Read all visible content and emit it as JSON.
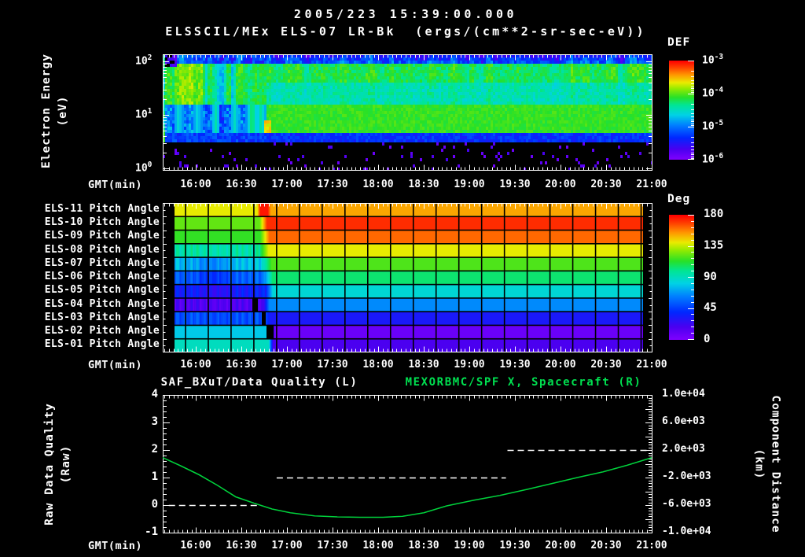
{
  "header": {
    "date_line": "2005/223 15:39:00.000",
    "instrument_line": "ELSSCIL/MEx ELS-07 LR-Bk  (ergs/(cm**2-sr-sec-eV))"
  },
  "axis": {
    "x_label": "GMT(min)",
    "x_tick_labels": [
      "16:00",
      "16:30",
      "17:00",
      "17:30",
      "18:00",
      "18:30",
      "19:00",
      "19:30",
      "20:00",
      "20:30",
      "21:00"
    ],
    "start_time": "15:38",
    "end_time": "21:01",
    "minutes_span": 322.5
  },
  "colors": {
    "background": "#000000",
    "axis": "#ffffff",
    "right_series_green": "#00d23c",
    "quality_dash_white": "#ffffff"
  },
  "colormap_stops": [
    [
      0.0,
      127,
      0,
      255
    ],
    [
      0.1,
      75,
      0,
      240
    ],
    [
      0.22,
      0,
      40,
      255
    ],
    [
      0.35,
      0,
      130,
      255
    ],
    [
      0.45,
      0,
      210,
      230
    ],
    [
      0.55,
      0,
      230,
      150
    ],
    [
      0.63,
      40,
      225,
      40
    ],
    [
      0.72,
      150,
      235,
      0
    ],
    [
      0.78,
      235,
      235,
      0
    ],
    [
      0.86,
      255,
      150,
      0
    ],
    [
      0.93,
      255,
      70,
      0
    ],
    [
      1.0,
      255,
      0,
      0
    ]
  ],
  "chart_data": [
    {
      "id": "electron-energy-spectrogram",
      "type": "heatmap",
      "title": "ELSSCIL/MEx ELS-07 LR-Bk",
      "units": "(ergs/(cm**2-sr-sec-eV))",
      "xlabel": "GMT(min)",
      "ylabel_line1": "Electron Energy",
      "ylabel_line2": "(eV)",
      "y_scale": "log",
      "y_range_ev": [
        1,
        135
      ],
      "y_tick_labels": [
        {
          "base": "10",
          "exp": "2"
        },
        {
          "base": "10",
          "exp": "1"
        },
        {
          "base": "10",
          "exp": "0"
        }
      ],
      "colorbar": {
        "label": "DEF",
        "tick_labels": [
          {
            "base": "10",
            "exp": "-3"
          },
          {
            "base": "10",
            "exp": "-4"
          },
          {
            "base": "10",
            "exp": "-5"
          },
          {
            "base": "10",
            "exp": "-6"
          }
        ],
        "min_flux": "1e-6",
        "max_flux": "1e-3"
      },
      "transition_minute": 69,
      "bands_pre": [
        {
          "e": [
            1,
            3.2
          ],
          "u": -1,
          "speckle_p": 0.05,
          "speckle_u": 0.08
        },
        {
          "e": [
            3.2,
            4.6
          ],
          "u": 0.25,
          "noise": 0.06
        },
        {
          "e": [
            4.6,
            15
          ],
          "u": 0.33,
          "noise": 0.1,
          "streak": 0.1,
          "id": "pre-low"
        },
        {
          "e": [
            15,
            90
          ],
          "u": 0.62,
          "noise": 0.05,
          "streak": 0.08,
          "boost_t": [
            8,
            26
          ],
          "boost": 0.07,
          "dip_t": [
            28,
            50
          ],
          "dip": 0.1
        },
        {
          "e": [
            90,
            135
          ],
          "u": 0.28,
          "noise": 0.09,
          "streak": 0.12
        }
      ],
      "bands_post": [
        {
          "e": [
            1,
            3.2
          ],
          "u": -1,
          "speckle_p": 0.05,
          "speckle_u": 0.08
        },
        {
          "e": [
            3.2,
            4.6
          ],
          "u": 0.23,
          "noise": 0.05
        },
        {
          "e": [
            4.6,
            15
          ],
          "u": 0.64,
          "noise": 0.03
        },
        {
          "e": [
            15,
            38
          ],
          "u": 0.52,
          "noise": 0.05,
          "streak": 0.04
        },
        {
          "e": [
            38,
            95
          ],
          "u": 0.6,
          "noise": 0.05,
          "streak": 0.08
        },
        {
          "e": [
            95,
            135
          ],
          "u": 0.28,
          "noise": 0.08,
          "streak": 0.14,
          "fade_top": 0.12
        }
      ],
      "features": [
        {
          "type": "dark_blocks",
          "t": [
            0,
            9
          ],
          "e": [
            80,
            135
          ]
        },
        {
          "type": "bright_left_edge",
          "t": [
            0,
            2
          ]
        },
        {
          "type": "bright_spot",
          "t": [
            67.5,
            71.5
          ],
          "e": [
            4.6,
            7.5
          ],
          "u": 0.8
        }
      ]
    },
    {
      "id": "pitch-angle-panel",
      "type": "heatmap",
      "xlabel": "GMT(min)",
      "colorbar": {
        "label": "Deg",
        "ticks": [
          180,
          135,
          90,
          45,
          0
        ],
        "min": 0,
        "max": 180
      },
      "cell_minutes": 15,
      "no_data_minutes": [
        [
          0,
          7.5
        ],
        [
          316,
          322.5
        ]
      ],
      "rows": [
        {
          "label": "ELS-11 Pitch Angle",
          "left_deg": 140,
          "right_deg": 152,
          "switch_min": 69,
          "blend_min": 3,
          "patch": {
            "t": [
              62,
              71
            ],
            "deg": 176
          },
          "gaps": [],
          "striation": false
        },
        {
          "label": "ELS-10 Pitch Angle",
          "left_deg": 122,
          "right_deg": 172,
          "switch_min": 66,
          "blend_min": 5,
          "patch": null,
          "gaps": [],
          "striation": false
        },
        {
          "label": "ELS-09 Pitch Angle",
          "left_deg": 115,
          "right_deg": 162,
          "switch_min": 67,
          "blend_min": 6,
          "patch": null,
          "gaps": [],
          "striation": false
        },
        {
          "label": "ELS-08 Pitch Angle",
          "left_deg": 95,
          "right_deg": 140,
          "switch_min": 66,
          "blend_min": 7,
          "patch": null,
          "gaps": [],
          "striation": true
        },
        {
          "label": "ELS-07 Pitch Angle",
          "left_deg": 78,
          "right_deg": 119,
          "switch_min": 68,
          "blend_min": 7,
          "patch": null,
          "gaps": [],
          "blob": {
            "c": 30,
            "s": 14,
            "d": -14
          },
          "striation": true
        },
        {
          "label": "ELS-06 Pitch Angle",
          "left_deg": 55,
          "right_deg": 104,
          "switch_min": 69,
          "blend_min": 6,
          "patch": null,
          "gaps": [],
          "blob": {
            "c": 32,
            "s": 13,
            "d": -12
          },
          "striation": true
        },
        {
          "label": "ELS-05 Pitch Angle",
          "left_deg": 36,
          "right_deg": 85,
          "switch_min": 70,
          "blend_min": 5,
          "patch": null,
          "gaps": [],
          "blob": {
            "c": 34,
            "s": 12,
            "d": -8
          },
          "striation": true
        },
        {
          "label": "ELS-04 Pitch Angle",
          "left_deg": 16,
          "right_deg": 65,
          "switch_min": 68,
          "blend_min": 4,
          "patch": null,
          "gaps": [
            [
              59,
              62.5
            ]
          ],
          "striation": true
        },
        {
          "label": "ELS-03 Pitch Angle",
          "left_deg": 50,
          "right_deg": 32,
          "switch_min": 69,
          "blend_min": 4,
          "patch": null,
          "gaps": [
            [
              65,
              67.5
            ]
          ],
          "striation": true
        },
        {
          "label": "ELS-02 Pitch Angle",
          "left_deg": 79,
          "right_deg": 7,
          "switch_min": 72,
          "blend_min": 3,
          "patch": null,
          "gaps": [
            [
              68,
              72.5
            ]
          ],
          "striation": false
        },
        {
          "label": "ELS-01 Pitch Angle",
          "left_deg": 90,
          "right_deg": 18,
          "switch_min": 71,
          "blend_min": 3,
          "patch": null,
          "gaps": [],
          "striation": false
        }
      ]
    },
    {
      "id": "quality-and-distance",
      "type": "line",
      "title_left": "SAF_BXuT/Data Quality (L)",
      "title_right": "MEXORBMC/SPF X, Spacecraft (R)",
      "xlabel": "GMT(min)",
      "y_left": {
        "label_line1": "Raw Data Quality",
        "label_line2": "(Raw)",
        "ticks": [
          4,
          3,
          2,
          1,
          0,
          -1
        ],
        "range": [
          -1,
          4
        ]
      },
      "y_right": {
        "label_line1": "Component Distance",
        "label_line2": "(km)",
        "tick_labels": [
          "1.0e+04",
          "6.0e+03",
          "2.0e+03",
          "-2.0e+03",
          "-6.0e+03",
          "-1.0e+04"
        ],
        "range": [
          -10000,
          10000
        ]
      },
      "series": [
        {
          "name": "SAF_BXuT/Data Quality",
          "axis": "left",
          "style": "dashed",
          "color": "#ffffff",
          "segments": [
            {
              "t": [
                4,
                63
              ],
              "value": 0
            },
            {
              "t": [
                75,
                226
              ],
              "value": 1
            },
            {
              "t": [
                227,
                320.5
              ],
              "value": 2
            }
          ]
        },
        {
          "name": "MEXORBMC/SPF X, Spacecraft",
          "axis": "right",
          "style": "solid",
          "color": "#00d23c",
          "points_min_km": [
            [
              0,
              880
            ],
            [
              12,
              -320
            ],
            [
              24,
              -1600
            ],
            [
              36,
              -3120
            ],
            [
              48,
              -4800
            ],
            [
              60,
              -5720
            ],
            [
              72,
              -6560
            ],
            [
              84,
              -7120
            ],
            [
              100,
              -7560
            ],
            [
              115,
              -7720
            ],
            [
              130,
              -7780
            ],
            [
              145,
              -7760
            ],
            [
              158,
              -7640
            ],
            [
              172,
              -7120
            ],
            [
              187,
              -6120
            ],
            [
              205,
              -5280
            ],
            [
              222,
              -4600
            ],
            [
              240,
              -3720
            ],
            [
              256,
              -2880
            ],
            [
              273,
              -2000
            ],
            [
              290,
              -1160
            ],
            [
              306,
              -200
            ],
            [
              322,
              880
            ]
          ]
        }
      ]
    }
  ]
}
